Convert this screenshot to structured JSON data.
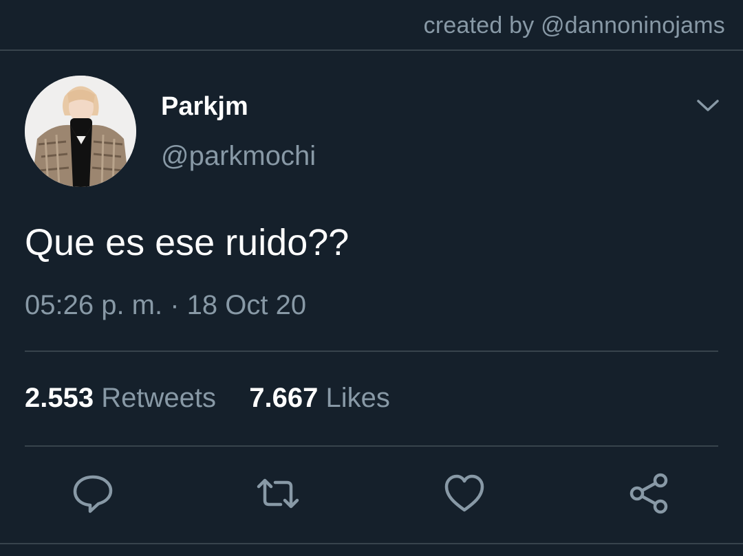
{
  "credit": "created by @dannoninojams",
  "tweet": {
    "display_name": "Parkjm",
    "handle": "@parkmochi",
    "text": "Que es ese ruido??",
    "timestamp": "05:26 p. m. · 18 Oct 20"
  },
  "stats": {
    "retweets_count": "2.553",
    "retweets_label": "Retweets",
    "likes_count": "7.667",
    "likes_label": "Likes"
  },
  "icons": {
    "menu": "chevron-down-icon",
    "reply": "reply-icon",
    "retweet": "retweet-icon",
    "like": "heart-icon",
    "share": "share-icon"
  },
  "colors": {
    "background": "#15202b",
    "secondary_text": "#8899a6",
    "divider": "#38444d",
    "primary_text": "#ffffff"
  }
}
